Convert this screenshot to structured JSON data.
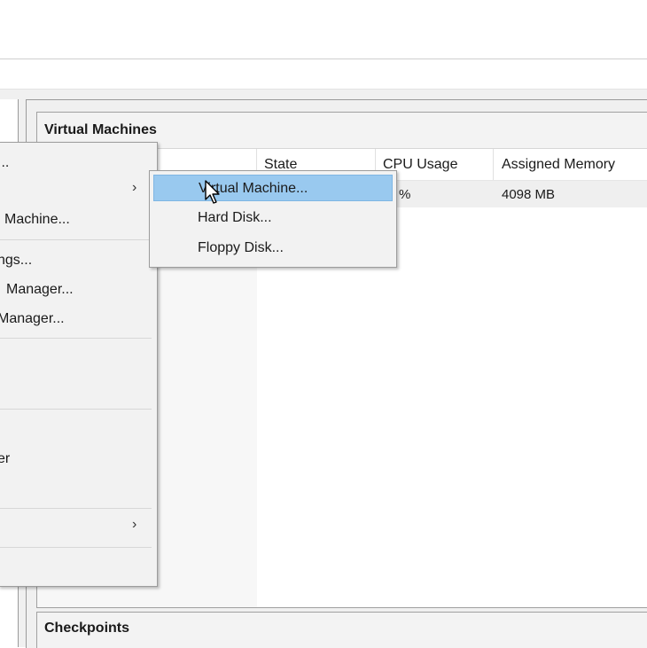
{
  "vm_panel": {
    "title": "Virtual Machines",
    "columns": [
      "State",
      "CPU Usage",
      "Assigned Memory"
    ],
    "rows": [
      {
        "cpu": "%",
        "memory": "4098 MB"
      }
    ]
  },
  "checkpoints": {
    "title": "Checkpoints"
  },
  "context_menu": {
    "items": [
      {
        "label": "...",
        "has_submenu": false
      },
      {
        "label": "",
        "has_submenu": true
      },
      {
        "label": "l Machine...",
        "has_submenu": false
      },
      {
        "label": "ngs...",
        "has_submenu": false
      },
      {
        "label": "Manager...",
        "has_submenu": false
      },
      {
        "label": "Manager...",
        "has_submenu": false
      },
      {
        "label": ".",
        "has_submenu": false
      },
      {
        "label": "er",
        "has_submenu": false
      },
      {
        "label": "",
        "has_submenu": true
      }
    ]
  },
  "submenu": {
    "items": [
      {
        "label": "Virtual Machine..."
      },
      {
        "label": "Hard Disk..."
      },
      {
        "label": "Floppy Disk..."
      }
    ]
  },
  "colors": {
    "highlight": "#99c9ef",
    "menu_bg": "#f2f2f2"
  }
}
